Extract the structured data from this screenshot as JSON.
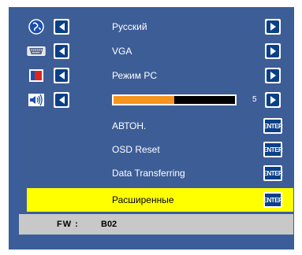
{
  "rows": [
    {
      "label": "Русский",
      "icon": "globe-icon"
    },
    {
      "label": "VGA",
      "icon": "vga-connector-icon"
    },
    {
      "label": "Режим PC",
      "icon": "display-mode-icon"
    },
    {
      "label": "",
      "icon": "speaker-icon"
    },
    {
      "label": "АВТОН."
    },
    {
      "label": "OSD Reset"
    },
    {
      "label": "Data Transferring"
    },
    {
      "label": "Расширенные"
    }
  ],
  "volume": {
    "value": "5",
    "fraction": 0.5
  },
  "enter_label": "ENTER",
  "firmware": {
    "label": "FW :",
    "value": "B02"
  },
  "colors": {
    "panel": "#3d5d97",
    "selected": "#ffff00",
    "slider": "#f7941d",
    "button": "#0b3f8a",
    "footer": "#c8c8c8"
  }
}
